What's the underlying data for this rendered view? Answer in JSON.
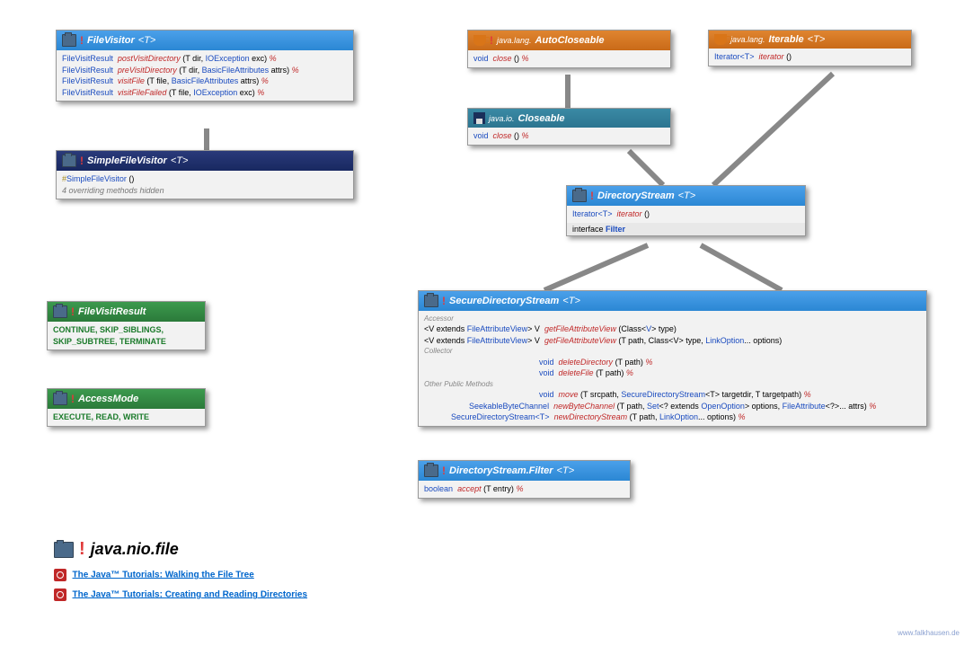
{
  "fileVisitor": {
    "name": "FileVisitor",
    "gp": "<T>",
    "rows": [
      {
        "ret": "FileVisitResult",
        "method": "postVisitDirectory",
        "params": " (T dir, ",
        "p2": "IOException",
        "p3": " exc) "
      },
      {
        "ret": "FileVisitResult",
        "method": "preVisitDirectory",
        "params": " (T dir, ",
        "p2": "BasicFileAttributes",
        "p3": " attrs) "
      },
      {
        "ret": "FileVisitResult",
        "method": "visitFile",
        "params": " (T file, ",
        "p2": "BasicFileAttributes",
        "p3": " attrs) "
      },
      {
        "ret": "FileVisitResult",
        "method": "visitFileFailed",
        "params": " (T file, ",
        "p2": "IOException",
        "p3": " exc) "
      }
    ]
  },
  "simpleFileVisitor": {
    "name": "SimpleFileVisitor",
    "gp": "<T>",
    "ctor": "SimpleFileVisitor",
    "note": "4 overriding methods hidden"
  },
  "fileVisitResult": {
    "name": "FileVisitResult",
    "vals": "CONTINUE, SKIP_SIBLINGS, SKIP_SUBTREE, TERMINATE"
  },
  "accessMode": {
    "name": "AccessMode",
    "vals": "EXECUTE, READ, WRITE"
  },
  "autoCloseable": {
    "pkg": "java.lang.",
    "name": "AutoCloseable",
    "ret": "void",
    "method": "close",
    "params": " () "
  },
  "iterable": {
    "pkg": "java.lang.",
    "name": "Iterable",
    "gp": "<T>",
    "ret": "Iterator<T>",
    "method": "iterator",
    "params": " ()"
  },
  "closeable": {
    "pkg": "java.io.",
    "name": "Closeable",
    "ret": "void",
    "method": "close",
    "params": " () "
  },
  "directoryStream": {
    "name": "DirectoryStream",
    "gp": "<T>",
    "ret": "Iterator<T>",
    "method": "iterator",
    "params": " ()",
    "sub1": "interface ",
    "sub2": "Filter"
  },
  "secureDirectoryStream": {
    "name": "SecureDirectoryStream",
    "gp": "<T>",
    "sects": {
      "accessor": "Accessor",
      "collector": "Collector",
      "other": "Other Public Methods"
    },
    "rows": {
      "a1": {
        "pre": "<V extends ",
        "t1": "FileAttributeView",
        "post": "> V",
        "method": "getFileAttributeView",
        "params": " (Class<",
        "t2": "V",
        "params2": "> type)"
      },
      "a2": {
        "pre": "<V extends ",
        "t1": "FileAttributeView",
        "post": "> V",
        "method": "getFileAttributeView",
        "params": " (T path, Class<V> type, ",
        "t2": "LinkOption",
        "params2": "... options)"
      },
      "c1": {
        "ret": "void",
        "method": "deleteDirectory",
        "params": " (T path) "
      },
      "c2": {
        "ret": "void",
        "method": "deleteFile",
        "params": " (T path) "
      },
      "o1": {
        "ret": "void",
        "method": "move",
        "params": " (T srcpath, ",
        "t2": "SecureDirectoryStream",
        "params2": "<T> targetdir, T targetpath) "
      },
      "o2": {
        "ret": "SeekableByteChannel",
        "method": "newByteChannel",
        "params": " (T path, ",
        "t2": "Set",
        "params2": "<? extends ",
        "t3": "OpenOption",
        "params3": "> options, ",
        "t4": "FileAttribute",
        "params4": "<?>... attrs) "
      },
      "o3": {
        "ret": "SecureDirectoryStream<T>",
        "method": "newDirectoryStream",
        "params": " (T path, ",
        "t2": "LinkOption",
        "params2": "... options) "
      }
    }
  },
  "dsFilter": {
    "name": "DirectoryStream.Filter",
    "gp": "<T>",
    "ret": "boolean",
    "method": "accept",
    "params": " (T entry) "
  },
  "pkgTitle": {
    "name": "java.nio.file"
  },
  "tutorials": {
    "l1": "The Java™ Tutorials: Walking the File Tree",
    "l2": "The Java™ Tutorials: Creating and Reading Directories"
  },
  "footer": "www.falkhausen.de",
  "sym": {
    "hash": "#",
    "throws": "%"
  }
}
